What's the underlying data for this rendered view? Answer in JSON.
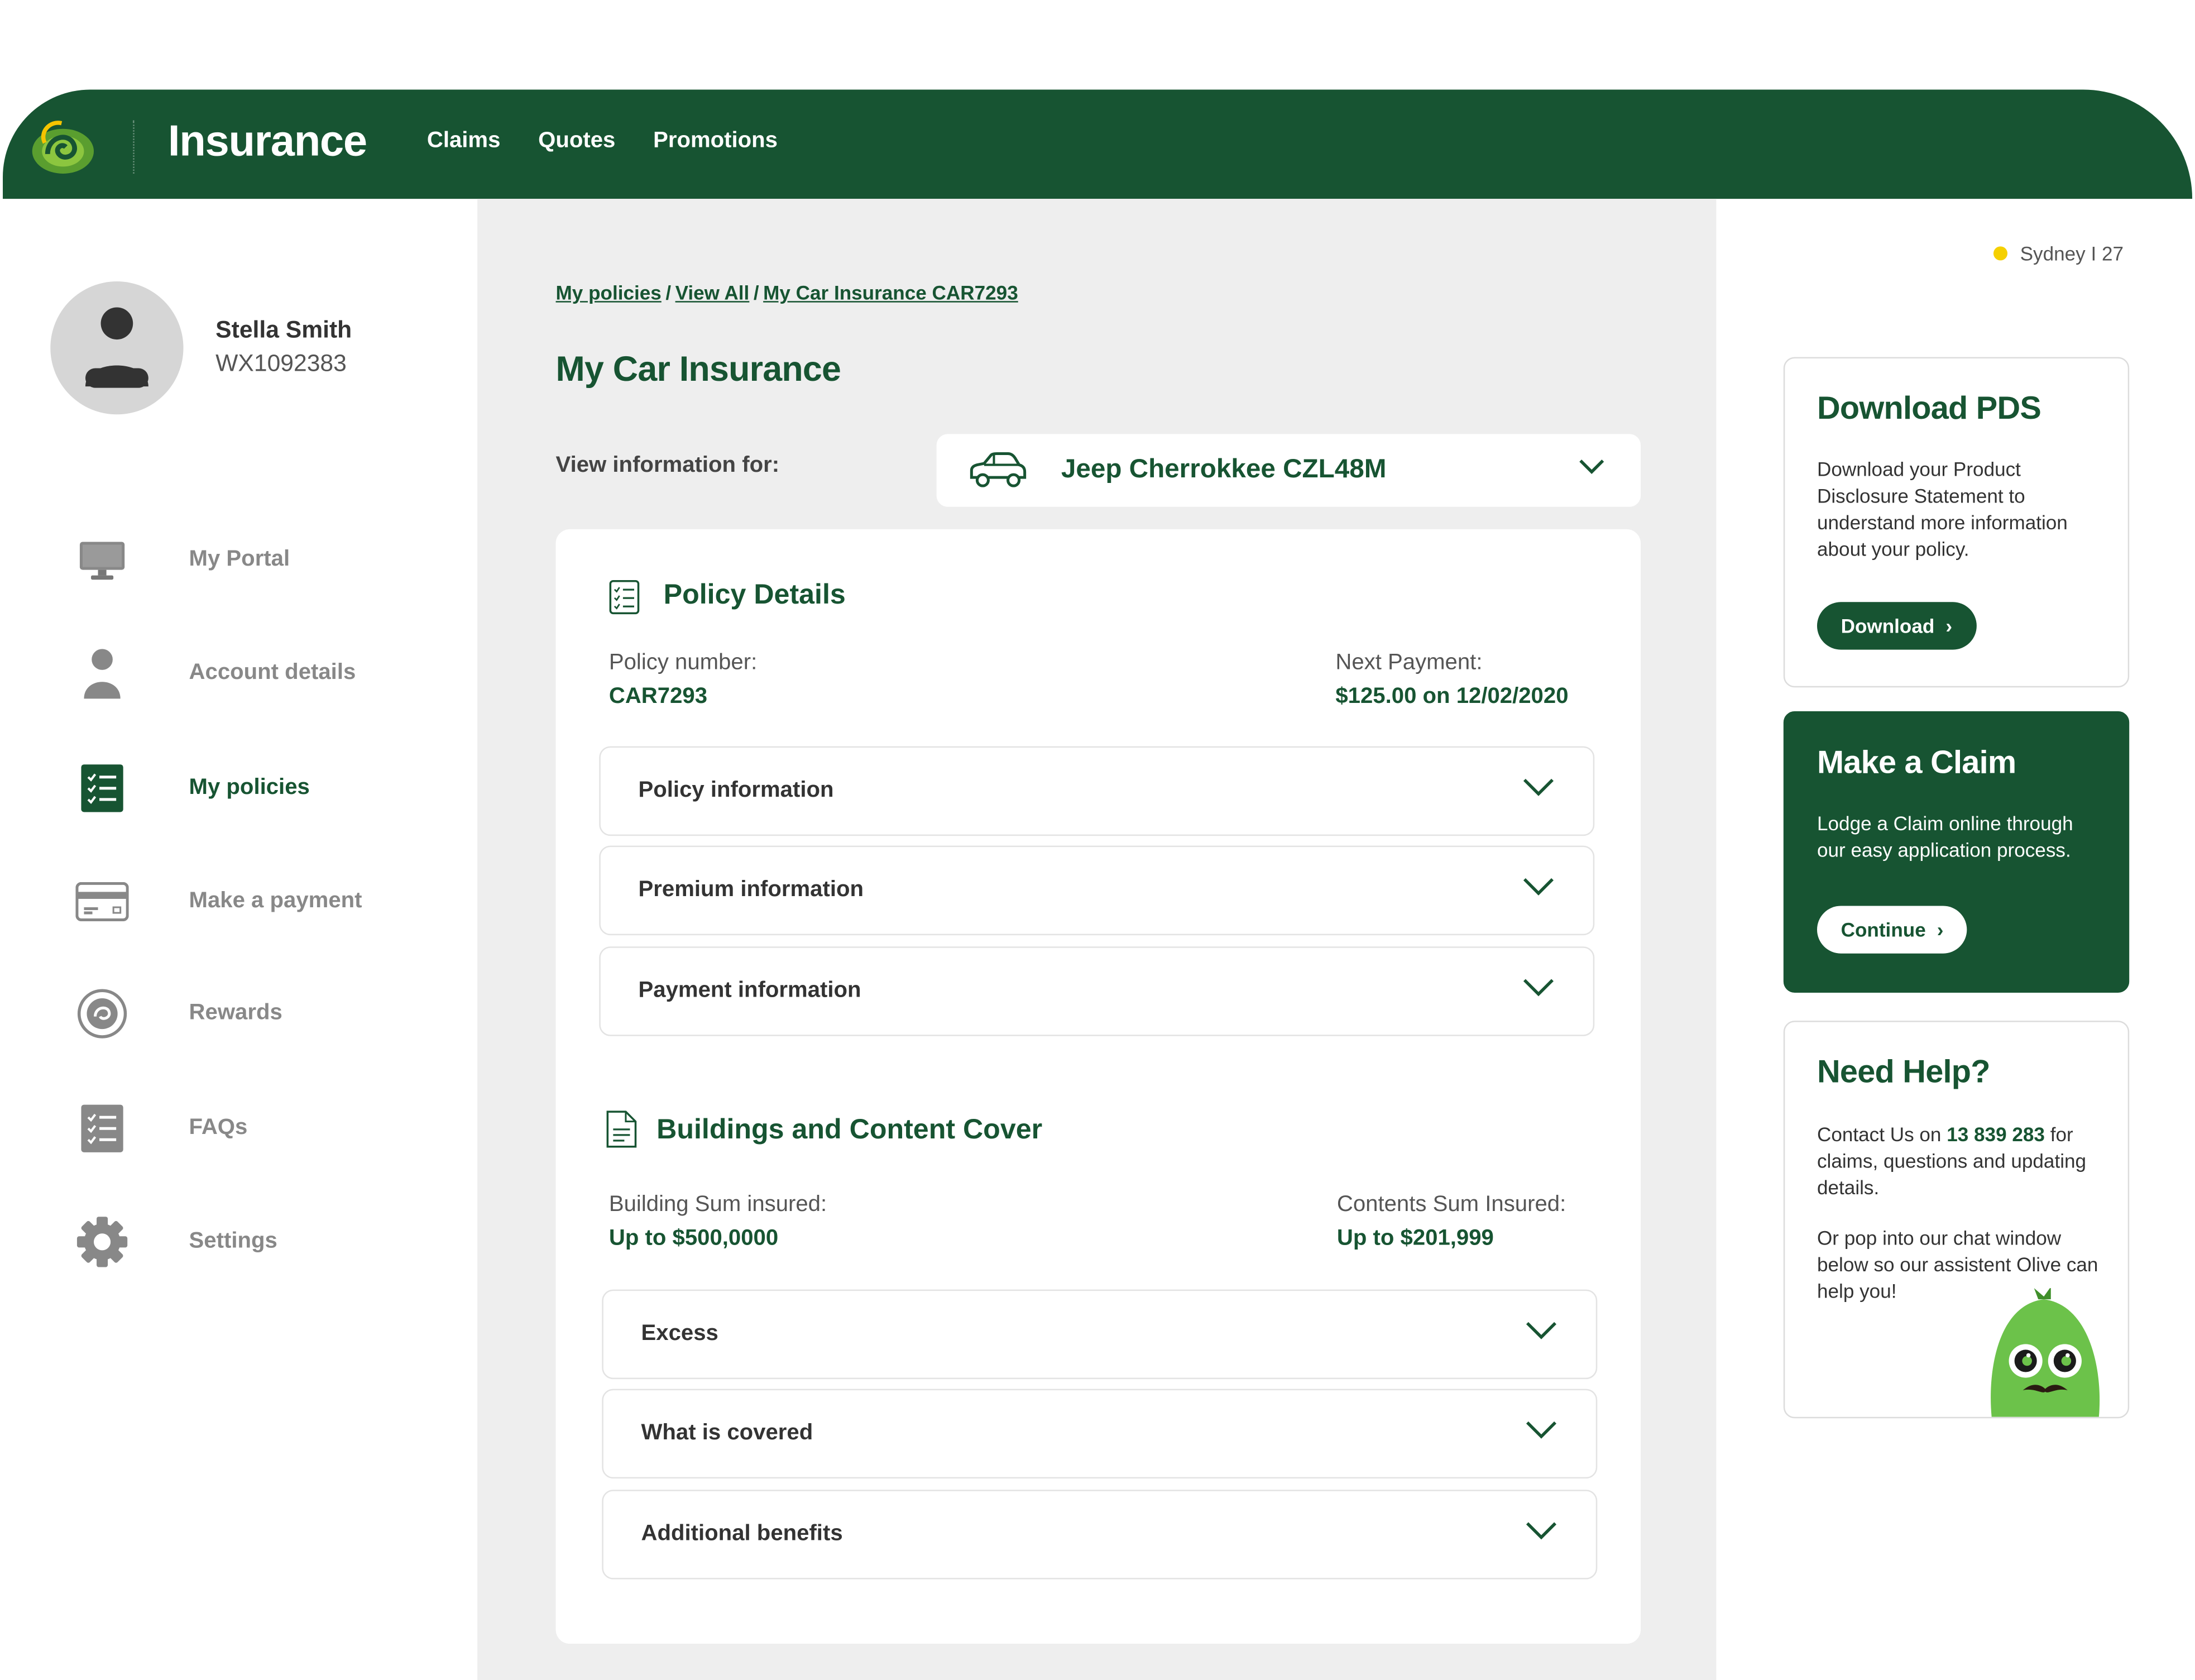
{
  "header": {
    "brand": "Insurance",
    "nav": [
      "Claims",
      "Quotes",
      "Promotions"
    ]
  },
  "user": {
    "name": "Stella Smith",
    "id": "WX1092383"
  },
  "sidebar": {
    "items": [
      {
        "label": "My Portal",
        "icon": "monitor-icon"
      },
      {
        "label": "Account details",
        "icon": "person-icon"
      },
      {
        "label": "My policies",
        "icon": "checklist-icon",
        "active": true
      },
      {
        "label": "Make a payment",
        "icon": "card-icon"
      },
      {
        "label": "Rewards",
        "icon": "rewards-icon"
      },
      {
        "label": "FAQs",
        "icon": "faq-icon"
      },
      {
        "label": "Settings",
        "icon": "gear-icon"
      }
    ]
  },
  "breadcrumb": [
    "My policies",
    "View All",
    "My Car Insurance CAR7293"
  ],
  "page_title": "My Car Insurance",
  "view_info": {
    "label": "View information for:",
    "vehicle": "Jeep Cherrokkee CZL48M"
  },
  "policy": {
    "title": "Policy Details",
    "number_label": "Policy number:",
    "number": "CAR7293",
    "next_payment_label": "Next Payment:",
    "next_payment": "$125.00 on 12/02/2020",
    "accordions": [
      "Policy information",
      "Premium information",
      "Payment information"
    ]
  },
  "cover": {
    "title": "Buildings and Content Cover",
    "building_label": "Building Sum insured:",
    "building_value": "Up to $500,0000",
    "contents_label": "Contents Sum Insured:",
    "contents_value": "Up to $201,999",
    "accordions": [
      "Excess",
      "What is covered",
      "Additional benefits"
    ]
  },
  "location": "Sydney I 27",
  "download_pds": {
    "title": "Download PDS",
    "text": "Download your Product Disclosure Statement to understand more information about your policy.",
    "button": "Download"
  },
  "make_claim": {
    "title": "Make a Claim",
    "text": "Lodge a Claim online through our easy application process.",
    "button": "Continue"
  },
  "need_help": {
    "title": "Need Help?",
    "text1_prefix": "Contact Us on ",
    "phone": "13 839 283",
    "text1_suffix": " for claims, questions and updating details.",
    "text2": "Or pop into our chat window below so our assistent Olive can help you!"
  },
  "colors": {
    "brand_green": "#175432",
    "location_dot": "#f5d000",
    "mascot_green": "#6cc24a"
  }
}
